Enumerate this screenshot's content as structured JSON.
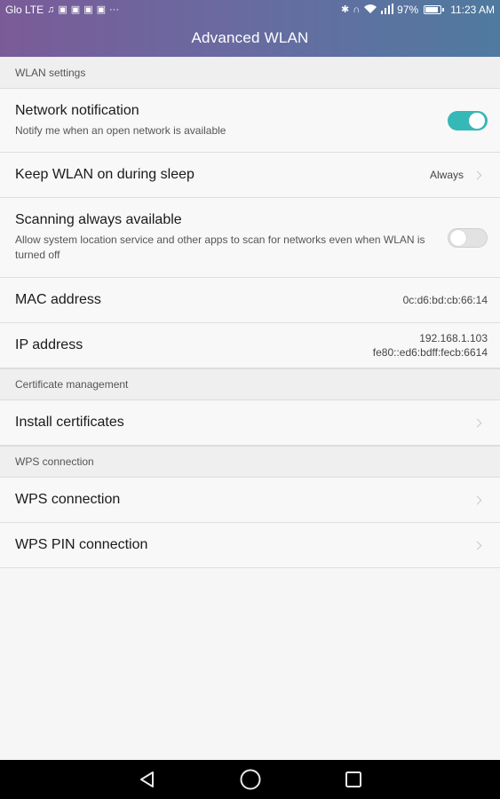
{
  "status_bar": {
    "carrier": "Glo LTE",
    "battery": "97%",
    "time": "11:23 AM"
  },
  "header": {
    "title": "Advanced WLAN"
  },
  "sections": {
    "wlan_settings": {
      "title": "WLAN settings"
    },
    "certificate": {
      "title": "Certificate management"
    },
    "wps": {
      "title": "WPS connection"
    }
  },
  "items": {
    "network_notification": {
      "label": "Network notification",
      "sub": "Notify me when an open network is available",
      "toggle": "on"
    },
    "keep_wlan": {
      "label": "Keep WLAN on during sleep",
      "value": "Always"
    },
    "scanning": {
      "label": "Scanning always available",
      "sub": "Allow system location service and other apps to scan for networks even when WLAN is turned off",
      "toggle": "off"
    },
    "mac": {
      "label": "MAC address",
      "value": "0c:d6:bd:cb:66:14"
    },
    "ip": {
      "label": "IP address",
      "value_v4": "192.168.1.103",
      "value_v6": "fe80::ed6:bdff:fecb:6614"
    },
    "install_certs": {
      "label": "Install certificates"
    },
    "wps_connection": {
      "label": "WPS connection"
    },
    "wps_pin": {
      "label": "WPS PIN connection"
    }
  },
  "colors": {
    "accent": "#36b8b6",
    "header_gradient_start": "#7a5b98",
    "header_gradient_end": "#4f7a9f"
  },
  "nav": {
    "back_icon": "back-triangle-icon",
    "home_icon": "home-circle-icon",
    "recents_icon": "recents-square-icon"
  }
}
